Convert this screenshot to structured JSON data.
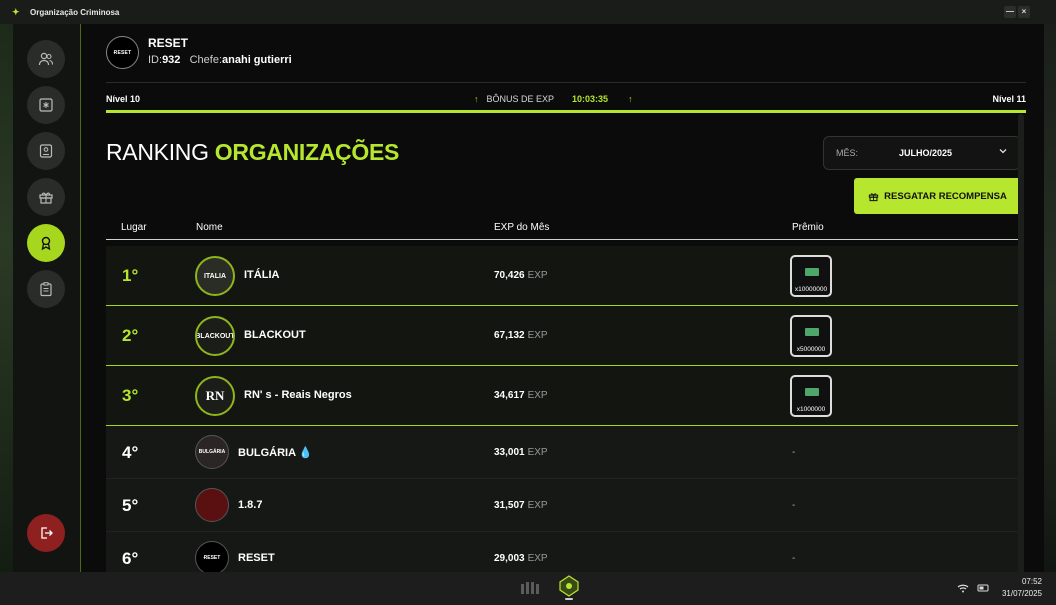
{
  "window": {
    "title": "Organização Criminosa",
    "minimize": "—",
    "close": "×"
  },
  "org": {
    "logo_text": "ɌESET",
    "name": "RESET",
    "id_label": "ID:",
    "id_value": "932",
    "boss_label": "Chefe:",
    "boss_value": "anahi gutierri"
  },
  "level_bar": {
    "current": "Nível 10",
    "next": "Nível 11",
    "bonus_label": "BÔNUS DE EXP",
    "bonus_time": "10:03:35",
    "progress": 1.0
  },
  "ranking": {
    "title_a": "RANKING",
    "title_b": "ORGANIZAÇÕES",
    "month_label": "MÊS:",
    "month_value": "JULHO/2025",
    "claim_label": "RESGATAR RECOMPENSA",
    "columns": [
      "Lugar",
      "Nome",
      "EXP do Mês",
      "Prêmio"
    ],
    "exp_unit": "EXP",
    "rows": [
      {
        "place": "1°",
        "name": "ITÁLIA",
        "exp": "70,426",
        "prize": "x10000000",
        "avatar_text": "ITALIA"
      },
      {
        "place": "2°",
        "name": "BLACKOUT",
        "exp": "67,132",
        "prize": "x5000000",
        "avatar_text": "BLACKOUT"
      },
      {
        "place": "3°",
        "name": "RN' s - Reais Negros",
        "exp": "34,617",
        "prize": "x1000000",
        "avatar_text": "RN"
      },
      {
        "place": "4°",
        "name": "BULGÁRIA",
        "exp": "33,001",
        "prize": "-",
        "avatar_text": "BULGÁRIA"
      },
      {
        "place": "5°",
        "name": "1.8.7",
        "exp": "31,507",
        "prize": "-",
        "avatar_text": ""
      },
      {
        "place": "6°",
        "name": "RESET",
        "exp": "29,003",
        "prize": "-",
        "avatar_text": "ɌESET"
      }
    ]
  },
  "taskbar": {
    "time": "07:52",
    "date": "31/07/2025"
  },
  "colors": {
    "accent": "#b6e62e",
    "logout": "#8e2020",
    "background": "#0a0b0a"
  },
  "icons": {
    "sidebar": [
      "users-icon",
      "star-box-icon",
      "id-card-icon",
      "gift-icon",
      "award-icon",
      "clipboard-icon",
      "logout-icon"
    ],
    "bonus": "arrow-up-icon",
    "prize": "money-icon",
    "blood": "blood-drop-icon"
  }
}
